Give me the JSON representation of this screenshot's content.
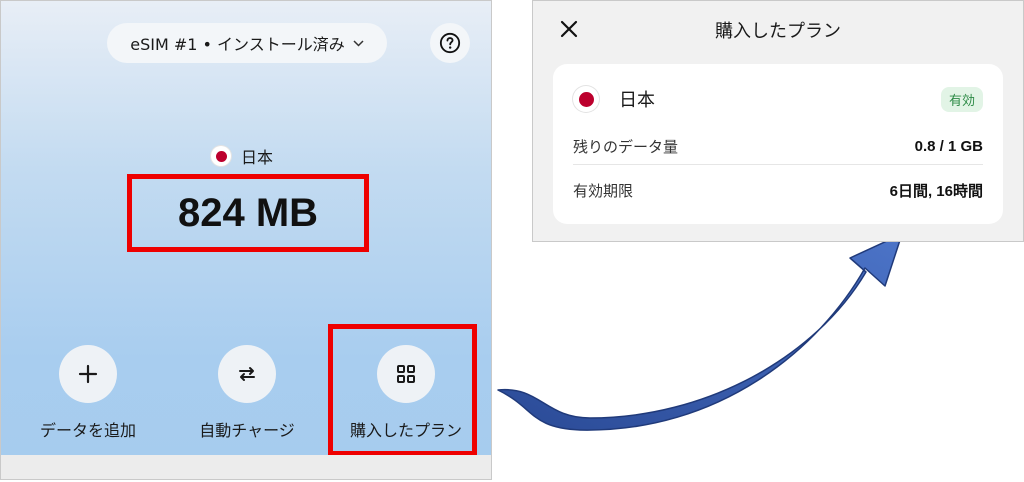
{
  "left_screen": {
    "esim_selector": {
      "label": "eSIM #1 • インストール済み"
    },
    "country": "日本",
    "data_remaining": "824 MB",
    "actions": [
      {
        "id": "add-data",
        "label": "データを追加",
        "icon": "plus-icon"
      },
      {
        "id": "auto-charge",
        "label": "自動チャージ",
        "icon": "swap-arrows-icon"
      },
      {
        "id": "purchased-plans",
        "label": "購入したプラン",
        "icon": "grid-icon"
      }
    ],
    "help_icon": "question-circle-icon"
  },
  "popup": {
    "title": "購入したプラン",
    "close_icon": "close-icon",
    "plan": {
      "country": "日本",
      "status": "有効",
      "rows": [
        {
          "label": "残りのデータ量",
          "value": "0.8 / 1 GB"
        },
        {
          "label": "有効期限",
          "value": "6日間, 16時間"
        }
      ]
    }
  },
  "colors": {
    "highlight": "#ee0000",
    "arrow": "#3b5fb0",
    "status_badge_bg": "#e2f4e6",
    "status_badge_text": "#2e8b47",
    "flag_red": "#bc002d"
  }
}
